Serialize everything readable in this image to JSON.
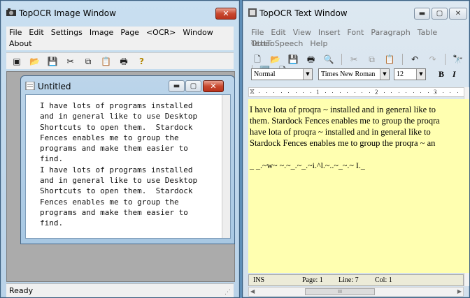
{
  "image_window": {
    "title": "TopOCR Image Window",
    "menu": [
      "File",
      "Edit",
      "Settings",
      "Image",
      "Page",
      "<OCR>",
      "Window",
      "About"
    ],
    "toolbar_icons": [
      "scanner-icon",
      "open-folder-icon",
      "save-icon",
      "cut-icon",
      "copy-icon",
      "paste-icon",
      "print-icon",
      "help-icon"
    ],
    "toolbar_glyphs": [
      "▣",
      "📂",
      "💾",
      "✂",
      "⧉",
      "📋",
      "🖶",
      "?"
    ],
    "status": "Ready",
    "child": {
      "title": "Untitled",
      "lines": [
        "I have lots of programs installed",
        "and in general like to use Desktop",
        "Shortcuts to open them.  Stardock",
        "Fences enables me to group the",
        "programs and make them easier to",
        "find.",
        "I have lots of programs installed",
        "and in general like to use Desktop",
        "Shortcuts to open them.  Stardock",
        "Fences enables me to group the",
        "programs and make them easier to",
        "find."
      ]
    }
  },
  "text_window": {
    "title": "TopOCR Text Window",
    "menu": [
      "File",
      "Edit",
      "View",
      "Insert",
      "Font",
      "Paragraph",
      "Table",
      "Other",
      "TextToSpeech",
      "Help"
    ],
    "toolbar_glyphs": [
      "🗋",
      "📂",
      "💾",
      "🖶",
      "🔍",
      "✂",
      "⧉",
      "📋",
      "↶",
      "↷",
      "🔭",
      "🔤",
      "🗋"
    ],
    "style_value": "Normal",
    "font_value": "Times New Roman",
    "size_value": "12",
    "bold_label": "B",
    "italic_label": "I",
    "ruler_numbers": [
      "1",
      "2",
      "3"
    ],
    "paragraph_lines": [
      "I have lota of proqra ~ installed and in general like to",
      "them. Stardock Fences enables me to group the proqra",
      "have lota of proqra ~ installed and in general like to",
      "Stardock Fences enables me to group the proqra ~ an"
    ],
    "garbage_line": "_ _.~w~ ~.~_.~_.~i.^l.~..~_~.~ I._",
    "status": {
      "mode": "INS",
      "page": "Page: 1",
      "line": "Line: 7",
      "col": "Col: 1"
    },
    "hscroll_thumb": "III"
  },
  "colors": {
    "editor_bg": "#ffffb0",
    "close_red": "#c9492f",
    "desktop": "#5f8fb8"
  }
}
